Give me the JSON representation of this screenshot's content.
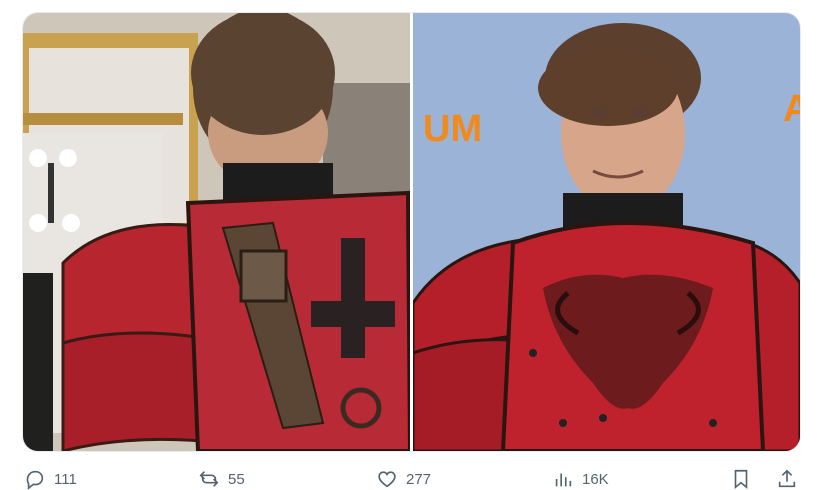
{
  "tweet": {
    "media": [
      {
        "alt": "back-view-red-armor-photo"
      },
      {
        "alt": "front-view-red-armor-photo",
        "background_text": "UM"
      }
    ],
    "actions": {
      "replies": "111",
      "retweets": "55",
      "likes": "277",
      "views": "16K"
    }
  },
  "colors": {
    "icon_gray": "#536471",
    "armor_red": "#b0202a",
    "backdrop_blue": "#9ab3d6",
    "backdrop_orange_text": "#f08a1c"
  }
}
